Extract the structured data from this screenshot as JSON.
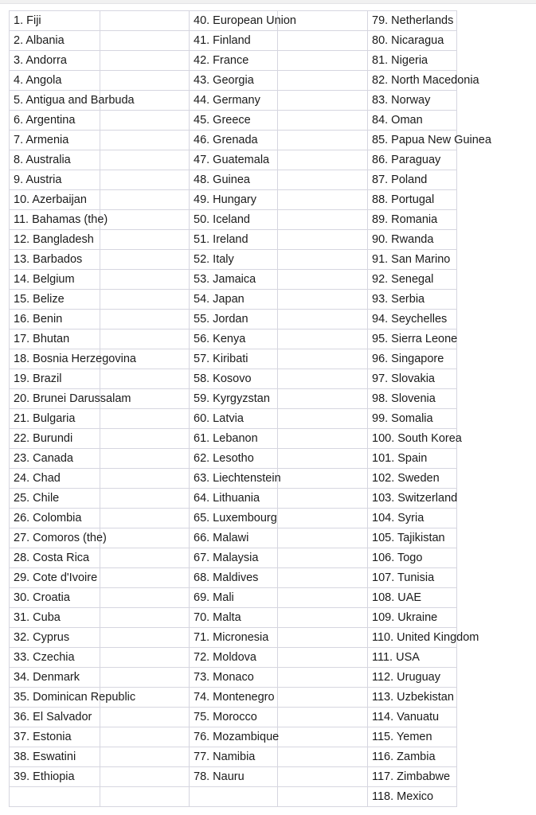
{
  "document": {
    "type": "country-list-table",
    "columns": 6,
    "rows": 40,
    "content_column_indices": [
      0,
      2,
      4
    ],
    "spacer_column_indices": [
      1,
      3,
      5
    ],
    "border_color": "#d6d6e0",
    "text_color": "#1b1b1b",
    "background_color": "#ffffff",
    "top_band_color": "#f1f1f1"
  },
  "table": {
    "rows": [
      {
        "col1": "1. Fiji",
        "col2": "",
        "col3": "40. European Union",
        "col4": "",
        "col5": "79. Netherlands",
        "col6": ""
      },
      {
        "col1": "2. Albania",
        "col2": "",
        "col3": "41. Finland",
        "col4": "",
        "col5": "80. Nicaragua",
        "col6": ""
      },
      {
        "col1": "3. Andorra",
        "col2": "",
        "col3": "42. France",
        "col4": "",
        "col5": "81. Nigeria",
        "col6": ""
      },
      {
        "col1": "4. Angola",
        "col2": "",
        "col3": "43. Georgia",
        "col4": "",
        "col5": "82. North Macedonia",
        "col6": ""
      },
      {
        "col1": "5. Antigua and Barbuda",
        "col2": "",
        "col3": "44. Germany",
        "col4": "",
        "col5": "83. Norway",
        "col6": ""
      },
      {
        "col1": "6. Argentina",
        "col2": "",
        "col3": "45. Greece",
        "col4": "",
        "col5": "84. Oman",
        "col6": ""
      },
      {
        "col1": "7. Armenia",
        "col2": "",
        "col3": "46. Grenada",
        "col4": "",
        "col5": "85. Papua New Guinea",
        "col6": ""
      },
      {
        "col1": "8. Australia",
        "col2": "",
        "col3": "47. Guatemala",
        "col4": "",
        "col5": "86. Paraguay",
        "col6": ""
      },
      {
        "col1": "9. Austria",
        "col2": "",
        "col3": "48. Guinea",
        "col4": "",
        "col5": "87. Poland",
        "col6": ""
      },
      {
        "col1": "10. Azerbaijan",
        "col2": "",
        "col3": "49. Hungary",
        "col4": "",
        "col5": "88. Portugal",
        "col6": ""
      },
      {
        "col1": "11. Bahamas (the)",
        "col2": "",
        "col3": "50. Iceland",
        "col4": "",
        "col5": "89. Romania",
        "col6": ""
      },
      {
        "col1": "12. Bangladesh",
        "col2": "",
        "col3": "51. Ireland",
        "col4": "",
        "col5": "90. Rwanda",
        "col6": ""
      },
      {
        "col1": "13. Barbados",
        "col2": "",
        "col3": "52. Italy",
        "col4": "",
        "col5": "91. San Marino",
        "col6": ""
      },
      {
        "col1": "14. Belgium",
        "col2": "",
        "col3": "53. Jamaica",
        "col4": "",
        "col5": "92. Senegal",
        "col6": ""
      },
      {
        "col1": "15. Belize",
        "col2": "",
        "col3": "54. Japan",
        "col4": "",
        "col5": "93. Serbia",
        "col6": ""
      },
      {
        "col1": "16. Benin",
        "col2": "",
        "col3": "55. Jordan",
        "col4": "",
        "col5": "94. Seychelles",
        "col6": ""
      },
      {
        "col1": "17. Bhutan",
        "col2": "",
        "col3": "56. Kenya",
        "col4": "",
        "col5": "95. Sierra Leone",
        "col6": ""
      },
      {
        "col1": "18. Bosnia Herzegovina",
        "col2": "",
        "col3": "57. Kiribati",
        "col4": "",
        "col5": "96. Singapore",
        "col6": ""
      },
      {
        "col1": "19. Brazil",
        "col2": "",
        "col3": "58. Kosovo",
        "col4": "",
        "col5": "97. Slovakia",
        "col6": ""
      },
      {
        "col1": "20. Brunei Darussalam",
        "col2": "",
        "col3": "59. Kyrgyzstan",
        "col4": "",
        "col5": "98. Slovenia",
        "col6": ""
      },
      {
        "col1": "21. Bulgaria",
        "col2": "",
        "col3": "60. Latvia",
        "col4": "",
        "col5": "99. Somalia",
        "col6": ""
      },
      {
        "col1": "22. Burundi",
        "col2": "",
        "col3": "61. Lebanon",
        "col4": "",
        "col5": "100. South Korea",
        "col6": ""
      },
      {
        "col1": "23. Canada",
        "col2": "",
        "col3": "62. Lesotho",
        "col4": "",
        "col5": "101. Spain",
        "col6": ""
      },
      {
        "col1": "24. Chad",
        "col2": "",
        "col3": "63. Liechtenstein",
        "col4": "",
        "col5": "102. Sweden",
        "col6": ""
      },
      {
        "col1": "25. Chile",
        "col2": "",
        "col3": "64. Lithuania",
        "col4": "",
        "col5": "103. Switzerland",
        "col6": ""
      },
      {
        "col1": "26. Colombia",
        "col2": "",
        "col3": "65. Luxembourg",
        "col4": "",
        "col5": "104. Syria",
        "col6": ""
      },
      {
        "col1": "27. Comoros (the)",
        "col2": "",
        "col3": "66. Malawi",
        "col4": "",
        "col5": "105. Tajikistan",
        "col6": ""
      },
      {
        "col1": "28. Costa Rica",
        "col2": "",
        "col3": "67. Malaysia",
        "col4": "",
        "col5": "106. Togo",
        "col6": ""
      },
      {
        "col1": "29. Cote d'Ivoire",
        "col2": "",
        "col3": "68. Maldives",
        "col4": "",
        "col5": "107. Tunisia",
        "col6": ""
      },
      {
        "col1": "30. Croatia",
        "col2": "",
        "col3": "69. Mali",
        "col4": "",
        "col5": "108. UAE",
        "col6": ""
      },
      {
        "col1": "31. Cuba",
        "col2": "",
        "col3": "70. Malta",
        "col4": "",
        "col5": "109. Ukraine",
        "col6": ""
      },
      {
        "col1": "32. Cyprus",
        "col2": "",
        "col3": "71. Micronesia",
        "col4": "",
        "col5": "110. United Kingdom",
        "col6": ""
      },
      {
        "col1": "33. Czechia",
        "col2": "",
        "col3": "72. Moldova",
        "col4": "",
        "col5": "111. USA",
        "col6": ""
      },
      {
        "col1": "34. Denmark",
        "col2": "",
        "col3": "73. Monaco",
        "col4": "",
        "col5": "112. Uruguay",
        "col6": ""
      },
      {
        "col1": "35. Dominican Republic",
        "col2": "",
        "col3": "74. Montenegro",
        "col4": "",
        "col5": "113. Uzbekistan",
        "col6": ""
      },
      {
        "col1": "36. El Salvador",
        "col2": "",
        "col3": "75. Morocco",
        "col4": "",
        "col5": "114. Vanuatu",
        "col6": ""
      },
      {
        "col1": "37. Estonia",
        "col2": "",
        "col3": "76. Mozambique",
        "col4": "",
        "col5": "115. Yemen",
        "col6": ""
      },
      {
        "col1": "38. Eswatini",
        "col2": "",
        "col3": "77. Namibia",
        "col4": "",
        "col5": "116. Zambia",
        "col6": ""
      },
      {
        "col1": "39. Ethiopia",
        "col2": "",
        "col3": "78. Nauru",
        "col4": "",
        "col5": "117. Zimbabwe",
        "col6": ""
      },
      {
        "col1": "",
        "col2": "",
        "col3": "",
        "col4": "",
        "col5": "118. Mexico",
        "col6": ""
      }
    ]
  }
}
